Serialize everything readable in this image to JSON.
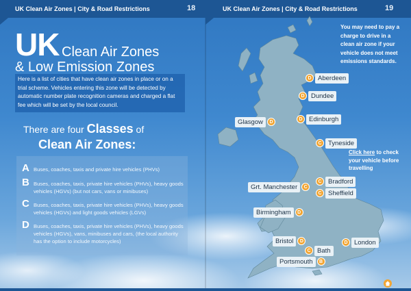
{
  "header": {
    "left_text": "UK Clean Air Zones | City & Road Restrictions",
    "left_page": "18",
    "right_text": "UK Clean Air Zones | City & Road Restrictions",
    "right_page": "19"
  },
  "title": {
    "uk": "UK",
    "line1": "Clean Air Zones",
    "line2": "& Low Emission Zones"
  },
  "intro": "Here is a list of cities that have clean air zones in place or on a trial scheme. Vehicles entering this zone will be detected by automatic number plate recognition cameras and charged a flat fee which will be set by the local council.",
  "classes_heading": {
    "pre": "There are four ",
    "big": "Classes",
    "post": " of",
    "line2": "Clean Air Zones:"
  },
  "classes": [
    {
      "letter": "A",
      "text": "Buses, coaches, taxis and private hire vehicles (PHVs)"
    },
    {
      "letter": "B",
      "text": "Buses, coaches, taxis, private hire vehicles (PHVs), heavy goods vehicles (HGVs) (but not cars, vans or minibuses)"
    },
    {
      "letter": "C",
      "text": "Buses, coaches, taxis, private hire vehicles (PHVs), heavy goods vehicles (HGVs) and light goods vehicles (LGVs)"
    },
    {
      "letter": "D",
      "text": "Buses, coaches, taxis, private hire vehicles (PHVs), heavy goods vehicles (HGVs), vans, minibuses and cars, (the local authority has the option to include motorcycles)"
    }
  ],
  "note": "You may need to pay a charge to drive in a clean air zone if your vehicle does not meet emissions standards.",
  "click": {
    "link": "Click here",
    "rest": " to check your vehicle before travelling"
  },
  "cities": [
    {
      "name": "Aberdeen",
      "class": "D"
    },
    {
      "name": "Dundee",
      "class": "D"
    },
    {
      "name": "Glasgow",
      "class": "D"
    },
    {
      "name": "Edinburgh",
      "class": "D"
    },
    {
      "name": "Tyneside",
      "class": "C"
    },
    {
      "name": "Bradford",
      "class": "C"
    },
    {
      "name": "Grt. Manchester",
      "class": "C"
    },
    {
      "name": "Sheffield",
      "class": "C"
    },
    {
      "name": "Birmingham",
      "class": "D"
    },
    {
      "name": "Bristol",
      "class": "D"
    },
    {
      "name": "London",
      "class": "D"
    },
    {
      "name": "Bath",
      "class": "C"
    },
    {
      "name": "Portsmouth",
      "class": "B"
    }
  ],
  "colors": {
    "header": "#1d5694",
    "marker": "#f2a532",
    "land": "#8fb2c4"
  },
  "icons": {
    "home": "home-icon"
  }
}
